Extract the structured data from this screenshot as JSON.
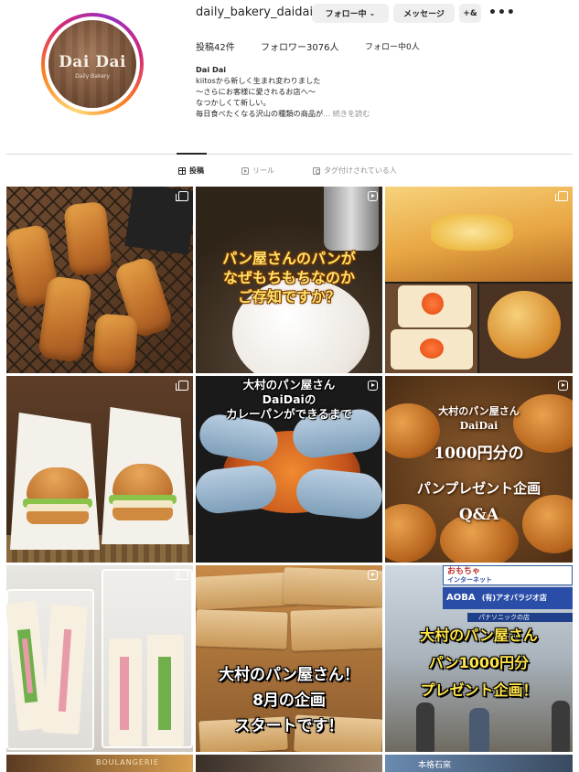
{
  "profile": {
    "username": "daily_bakery_daidai",
    "following_button": "フォロー中",
    "message_button": "メッセージ",
    "add_user_button": "+&",
    "avatar_logo": "Dai Dai",
    "avatar_sub": "Daily Bakery",
    "posts": "投稿42件",
    "followers": "フォロワー3076人",
    "following": "フォロー中0人",
    "bio": {
      "name": "Dai Dai",
      "line1": "kiitosから新しく生まれ変わりました",
      "line2": "～さらにお客様に愛されるお店へ～",
      "line3": "なつかしくて新しい。",
      "line4": "毎日食べたくなる沢山の種類の商品が",
      "more": "... 続きを読む"
    }
  },
  "tabs": [
    {
      "label": "投稿",
      "icon": "grid-icon",
      "active": true
    },
    {
      "label": "リール",
      "icon": "reels-icon",
      "active": false
    },
    {
      "label": "タグ付けされている人",
      "icon": "tagged-icon",
      "active": false
    }
  ],
  "posts": [
    {
      "type": "carousel",
      "subject": "pastries",
      "overlay": ""
    },
    {
      "type": "reel",
      "subject": "dough",
      "overlay_lines": [
        "パン屋さんのパンが",
        "なぜもちもちなのか",
        "ご存知ですか？"
      ]
    },
    {
      "type": "carousel",
      "subject": "toasts",
      "overlay": ""
    },
    {
      "type": "carousel",
      "subject": "burgers",
      "overlay": ""
    },
    {
      "type": "reel",
      "subject": "curry-bread",
      "overlay_lines": [
        "大村のパン屋さん",
        "DaiDaiの",
        "カレーパンができるまで"
      ]
    },
    {
      "type": "reel",
      "subject": "rolls",
      "overlay_lines": [
        "大村のパン屋さん",
        "DaiDai",
        "1000円分の",
        "パンプレゼント企画",
        "Q&A"
      ]
    },
    {
      "type": "carousel",
      "subject": "sandwiches",
      "overlay": ""
    },
    {
      "type": "reel",
      "subject": "packages",
      "overlay_lines": [
        "大村のパン屋さん！",
        "8月の企画",
        "スタートです！"
      ]
    },
    {
      "type": "reel",
      "subject": "storefront",
      "overlay_lines": [
        "大村のパン屋さん",
        "パン1000円分",
        "プレゼント企画！"
      ],
      "signs": [
        "おもちゃ",
        "インターネット",
        "AOBA",
        "(有)アオバラジオ店",
        "パナソニックの店"
      ]
    },
    {
      "type": "carousel",
      "subject": "partial",
      "overlay": "",
      "caption": "BOULANGERIE"
    },
    {
      "type": "reel",
      "subject": "partial",
      "overlay": ""
    },
    {
      "type": "reel",
      "subject": "partial",
      "overlay": "",
      "caption": "本格石窯"
    }
  ],
  "colors": {
    "text": "#262626",
    "muted": "#8e8e8e",
    "button_bg": "#efefef",
    "divider": "#dbdbdb"
  }
}
